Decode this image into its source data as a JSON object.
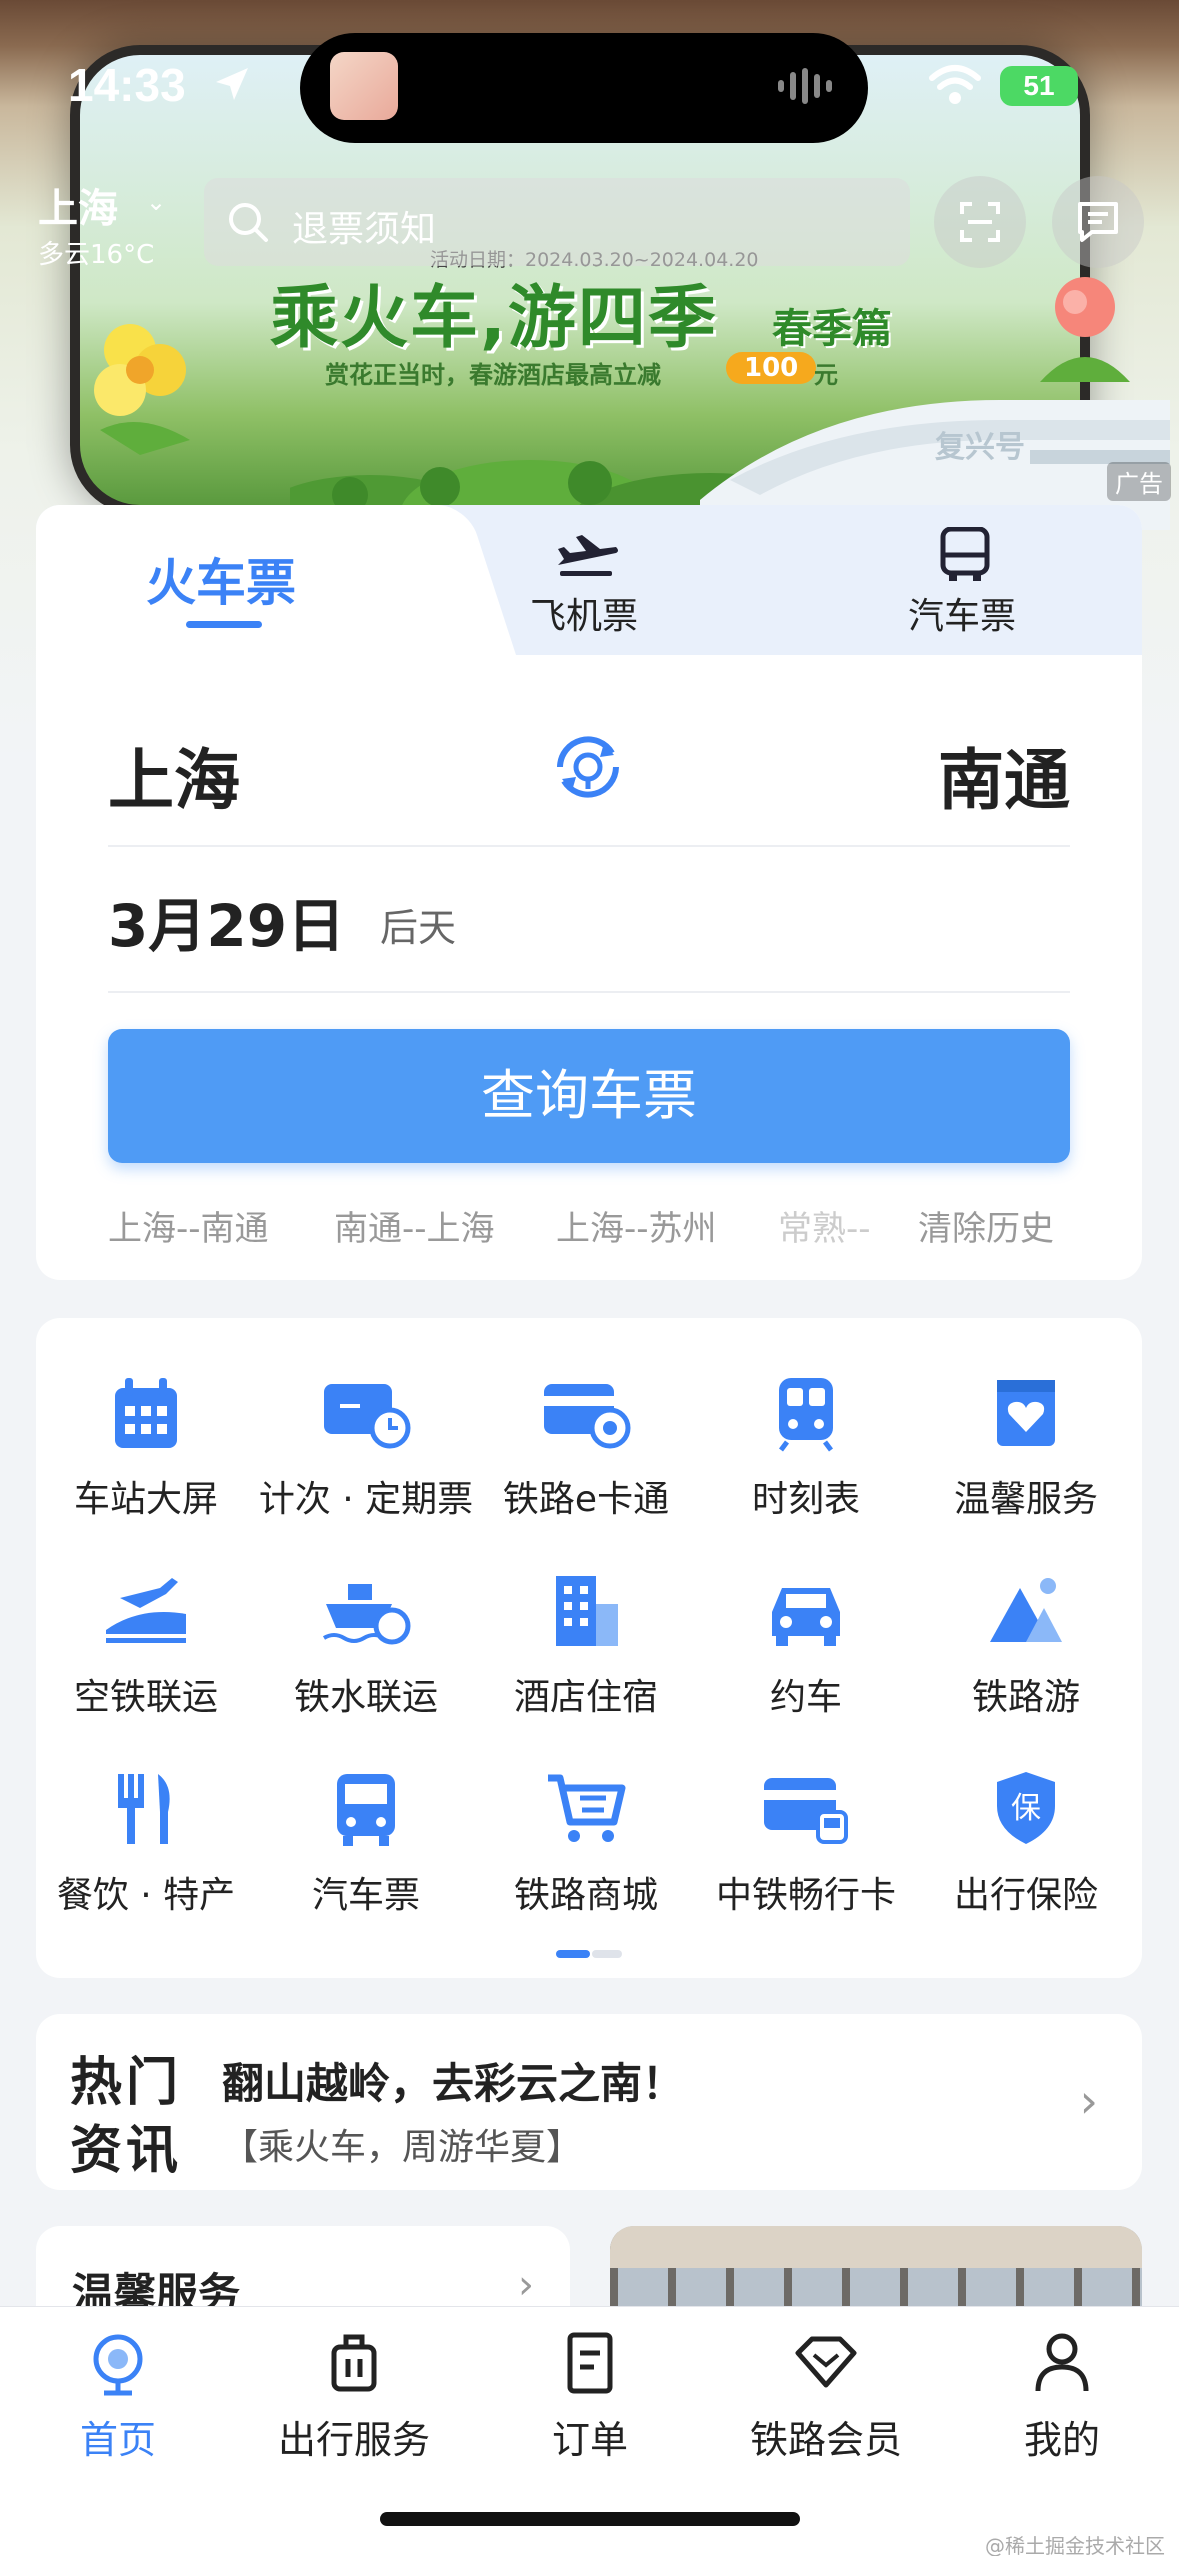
{
  "status_bar": {
    "time": "14:33",
    "battery": "51"
  },
  "header": {
    "city": "上海",
    "weather": "多云16°C",
    "search_placeholder": "退票须知",
    "scan_icon": "scan-icon",
    "message_icon": "message-icon"
  },
  "banner": {
    "activity_date": "活动日期：2024.03.20~2024.04.20",
    "title": "乘火车,游四季",
    "season": "春季篇",
    "subtitle": "赏花正当时，春游酒店最高立减",
    "amount": "100",
    "unit": "元",
    "train_name": "复兴号",
    "ad_label": "广告"
  },
  "ticket": {
    "tabs": [
      {
        "label": "火车票",
        "icon": "train-icon"
      },
      {
        "label": "飞机票",
        "icon": "airplane-icon"
      },
      {
        "label": "汽车票",
        "icon": "bus-icon"
      }
    ],
    "from": "上海",
    "to": "南通",
    "date": "3月29日",
    "date_hint": "后天",
    "query_button": "查询车票",
    "history": [
      "上海--南通",
      "南通--上海",
      "上海--苏州",
      "常熟--"
    ],
    "clear_history": "清除历史"
  },
  "services": [
    {
      "label": "车站大屏",
      "icon": "calendar-icon"
    },
    {
      "label": "计次 · 定期票",
      "icon": "ticket-clock-icon"
    },
    {
      "label": "铁路e卡通",
      "icon": "card-icon"
    },
    {
      "label": "时刻表",
      "icon": "train-front-icon"
    },
    {
      "label": "温馨服务",
      "icon": "heart-icon"
    },
    {
      "label": "空铁联运",
      "icon": "plane-train-icon"
    },
    {
      "label": "铁水联运",
      "icon": "ship-icon"
    },
    {
      "label": "酒店住宿",
      "icon": "building-icon"
    },
    {
      "label": "约车",
      "icon": "car-icon"
    },
    {
      "label": "铁路游",
      "icon": "mountain-icon"
    },
    {
      "label": "餐饮 · 特产",
      "icon": "fork-knife-icon"
    },
    {
      "label": "汽车票",
      "icon": "bus-icon"
    },
    {
      "label": "铁路商城",
      "icon": "cart-icon"
    },
    {
      "label": "中铁畅行卡",
      "icon": "card-train-icon"
    },
    {
      "label": "出行保险",
      "icon": "shield-icon"
    }
  ],
  "news": {
    "tag_line1": "热门",
    "tag_line2": "资讯",
    "title": "翻山越岭，去彩云之南！",
    "subtitle": "【乘火车，周游华夏】"
  },
  "warm_service": {
    "title": "温馨服务"
  },
  "tabbar": [
    {
      "label": "首页",
      "icon": "home-icon",
      "active": true
    },
    {
      "label": "出行服务",
      "icon": "luggage-icon",
      "active": false
    },
    {
      "label": "订单",
      "icon": "order-icon",
      "active": false
    },
    {
      "label": "铁路会员",
      "icon": "diamond-icon",
      "active": false
    },
    {
      "label": "我的",
      "icon": "person-icon",
      "active": false
    }
  ],
  "watermark": "@稀土掘金技术社区",
  "colors": {
    "accent": "#3b82f6",
    "button": "#4f9bf5",
    "badge": "#f6a91d",
    "promo_green": "#2f8a2a"
  }
}
